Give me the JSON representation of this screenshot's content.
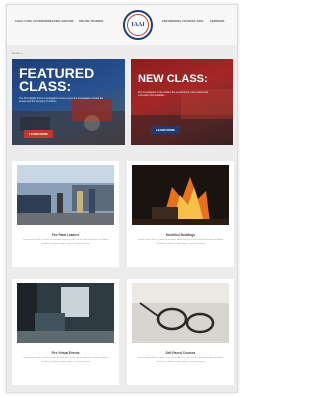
{
  "nav": {
    "left": [
      "Child Care Courses",
      "Breaking Ground",
      "Online Training"
    ],
    "right": [
      "Engineering Courses Tool",
      "Seminars"
    ]
  },
  "logo": {
    "text": "IAAI"
  },
  "breadcrumb": "Home »",
  "featured": {
    "title_line1": "Featured",
    "title_line2": "Class:",
    "text": "The Fire Fatality Scene Investigation course covers the investigation of fatal fire scenes and the recovery of victims...",
    "button": "Learn More"
  },
  "new_class": {
    "title": "New Class:",
    "text": "Fire investigation in the modern fire environment, new content and instruction now available...",
    "button": "Learn More"
  },
  "cards": [
    {
      "title": "Fire Fatal Leaders",
      "text": "Lorem ipsum dolor sit amet consectetur adipiscing elit sed do eiusmod tempor incididunt ut labore et dolore magna aliqua ut enim ad minim"
    },
    {
      "title": "Modelled Buildings",
      "text": "Lorem ipsum dolor sit amet consectetur adipiscing elit sed do eiusmod tempor incididunt ut labore et dolore magna aliqua ut enim ad minim"
    },
    {
      "title": "Fire Virtual Events",
      "text": "Lorem ipsum dolor sit amet consectetur adipiscing elit sed do eiusmod tempor incididunt ut labore et dolore magna aliqua ut enim ad minim"
    },
    {
      "title": "Self-Paced Courses",
      "text": "Lorem ipsum dolor sit amet consectetur adipiscing elit sed do eiusmod tempor incididunt ut labore et dolore magna aliqua ut enim ad minim"
    }
  ],
  "colors": {
    "brand_blue": "#1f3b73",
    "brand_red": "#c0392b"
  }
}
